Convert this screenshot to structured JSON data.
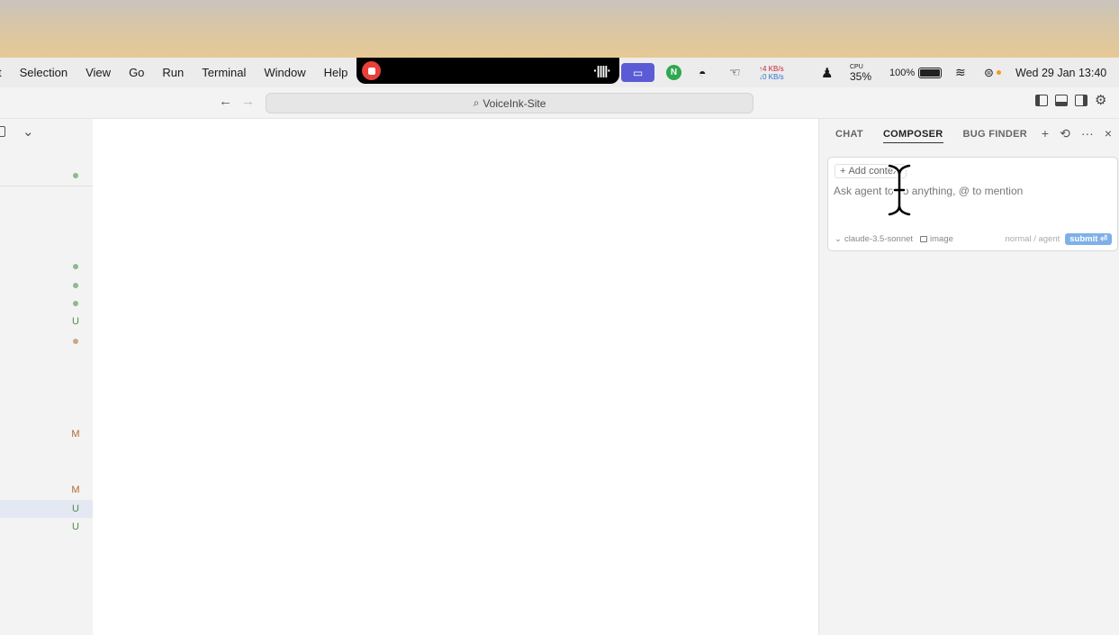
{
  "menubar": {
    "items": [
      "t",
      "Selection",
      "View",
      "Go",
      "Run",
      "Terminal",
      "Window",
      "Help"
    ],
    "net_up": "↑4 KB/s",
    "net_down": "↓0 KB/s",
    "cpu_label": "CPU",
    "cpu_value": "35%",
    "battery": "100%",
    "datetime": "Wed 29 Jan  13:40",
    "n_icon_letter": "N"
  },
  "titlebar": {
    "back_icon": "←",
    "forward_icon": "→",
    "search_icon": "⌕",
    "workspace": "VoiceInk-Site",
    "settings_icon": "⚙"
  },
  "sidebar": {
    "collapse_icon": "⌄",
    "marks": [
      {
        "kind": "dot",
        "color": "green"
      },
      {
        "kind": "dot",
        "color": "green"
      },
      {
        "kind": "dot",
        "color": "green"
      },
      {
        "kind": "dot",
        "color": "green"
      },
      {
        "kind": "letter",
        "text": "U"
      },
      {
        "kind": "dot",
        "color": "orange"
      },
      {
        "kind": "letter",
        "text": "M"
      },
      {
        "kind": "letter",
        "text": "M"
      },
      {
        "kind": "letter",
        "text": "U"
      },
      {
        "kind": "letter",
        "text": "U"
      }
    ]
  },
  "panel": {
    "tabs": [
      {
        "label": "CHAT",
        "active": false
      },
      {
        "label": "COMPOSER",
        "active": true
      },
      {
        "label": "BUG FINDER",
        "active": false
      }
    ],
    "actions": {
      "new": "+",
      "history": "⟲",
      "more": "···",
      "close": "×"
    },
    "composer": {
      "add_context_icon": "+",
      "add_context_label": "Add context",
      "placeholder": "Ask agent to do anything, @ to mention",
      "model_chevron": "⌄",
      "model": "claude-3.5-sonnet",
      "image_label": "image",
      "mode": "normal / agent",
      "submit_label": "submit ⏎"
    }
  },
  "colors": {
    "accent": "#5b5bd6",
    "record": "#e8403a",
    "submit": "#7fb0e8",
    "untracked": "#4d8c47",
    "modified": "#b06a2a"
  }
}
